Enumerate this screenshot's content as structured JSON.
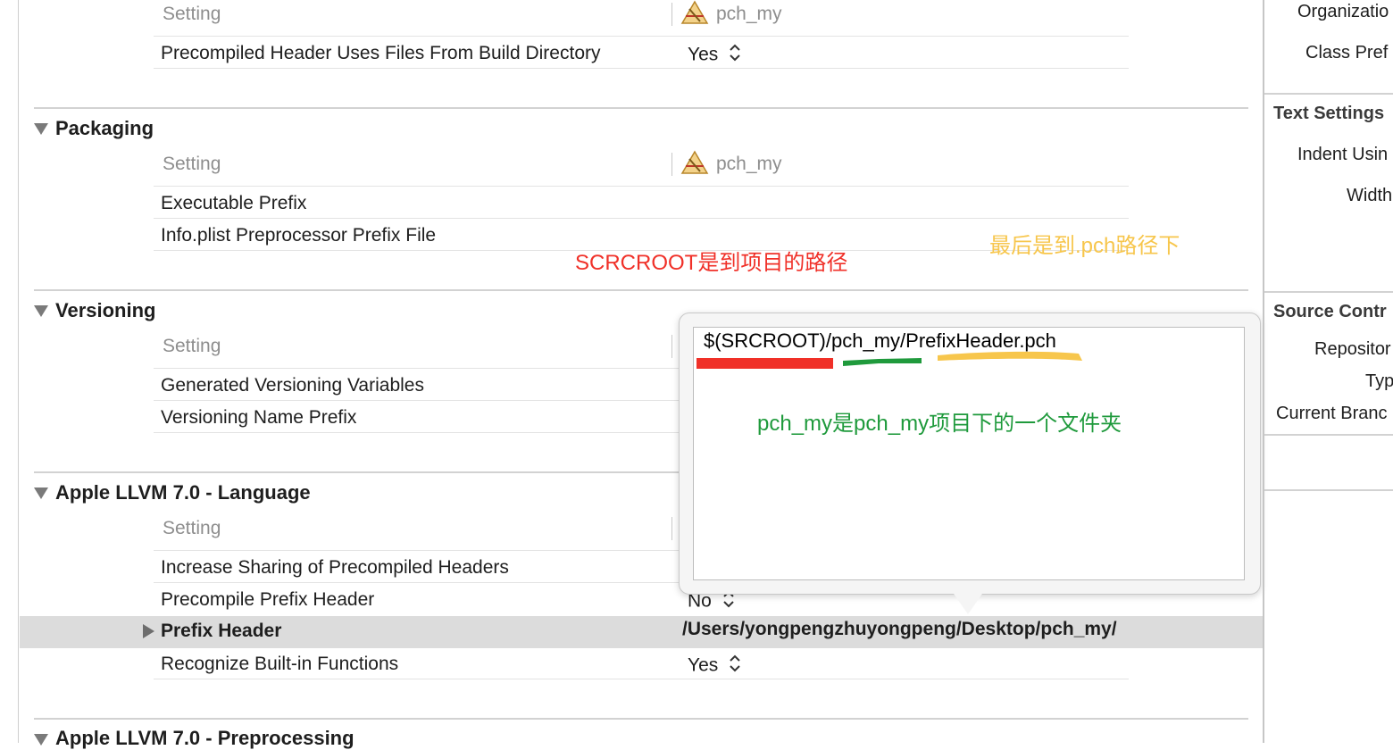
{
  "sections_top": {
    "setting_header": "Setting",
    "target_name": "pch_my",
    "row_label": "Precompiled Header Uses Files From Build Directory",
    "row_value": "Yes"
  },
  "packaging": {
    "title": "Packaging",
    "setting_header": "Setting",
    "target_name": "pch_my",
    "rows": [
      "Executable Prefix",
      "Info.plist Preprocessor Prefix File"
    ]
  },
  "versioning": {
    "title": "Versioning",
    "setting_header": "Setting",
    "rows": [
      "Generated Versioning Variables",
      "Versioning Name Prefix"
    ]
  },
  "llvm_language": {
    "title": "Apple LLVM 7.0 - Language",
    "setting_header": "Setting",
    "rows": [
      {
        "label": "Increase Sharing of Precompiled Headers",
        "value": ""
      },
      {
        "label": "Precompile Prefix Header",
        "value": "No"
      },
      {
        "label": "Prefix Header",
        "value": "/Users/yongpengzhuyongpeng/Desktop/pch_my/"
      },
      {
        "label": "Recognize Built-in Functions",
        "value": "Yes"
      }
    ]
  },
  "llvm_preprocessing": {
    "title": "Apple LLVM 7.0 - Preprocessing"
  },
  "popover": {
    "value": "$(SRCROOT)/pch_my/PrefixHeader.pch"
  },
  "annotations": {
    "srcroot": "SCRCROOT是到项目的路径",
    "last": "最后是到.pch路径下",
    "folder": "pch_my是pch_my项目下的一个文件夹",
    "red": "#f03028",
    "green": "#1f9a3c",
    "yellow": "#f7c64c"
  },
  "right_panel": {
    "organization": "Organizatio",
    "class_prefix": "Class Pref",
    "text_settings": "Text Settings",
    "indent_using": "Indent Usin",
    "widths": "Width",
    "source_control": "Source Contr",
    "repository": "Repositor",
    "type": "Typ",
    "current_branch": "Current Branc"
  }
}
